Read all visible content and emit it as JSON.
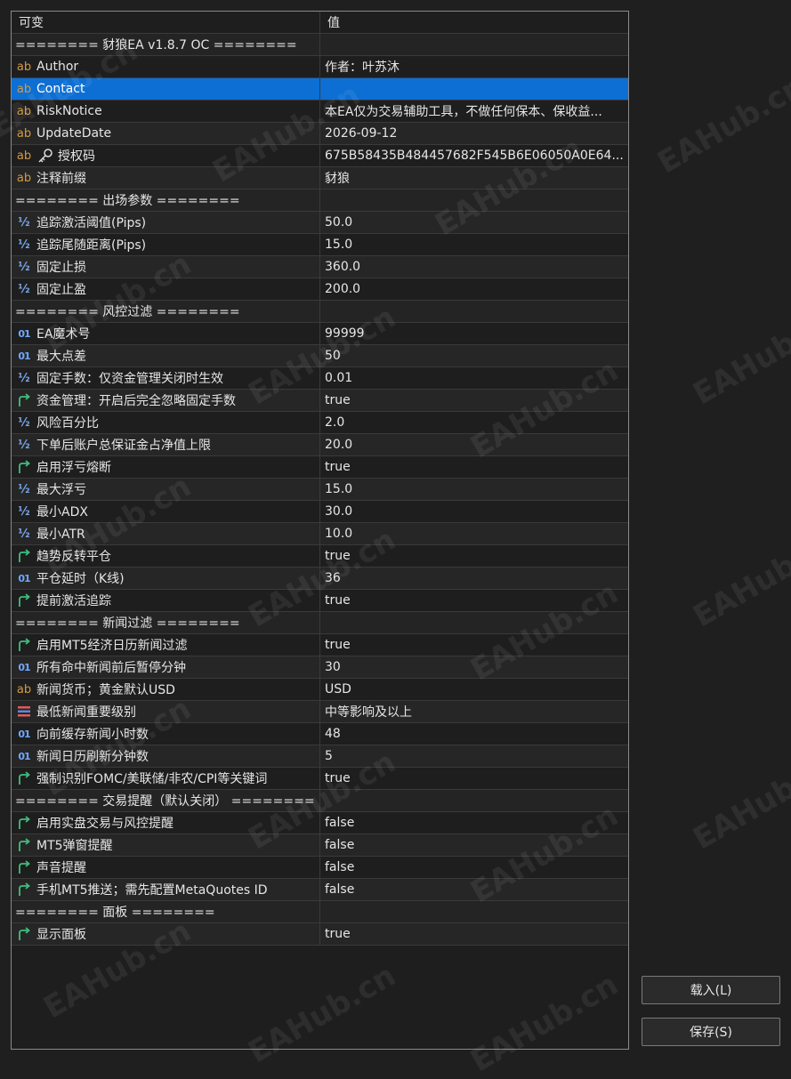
{
  "header": {
    "name": "可变",
    "value": "值"
  },
  "rows": [
    {
      "type": "section",
      "name": "======== 豺狼EA v1.8.7 OC ========",
      "value": ""
    },
    {
      "type": "str",
      "name": "Author",
      "value": "作者：叶苏沐"
    },
    {
      "type": "str",
      "name": "Contact",
      "value": "",
      "selected": true
    },
    {
      "type": "str",
      "name": "RiskNotice",
      "value": "本EA仅为交易辅助工具，不做任何保本、保收益..."
    },
    {
      "type": "str",
      "name": "UpdateDate",
      "value": "2026-09-12"
    },
    {
      "type": "str",
      "name": "授权码",
      "value": "675B58435B484457682F545B6E06050A0E64...",
      "key": true
    },
    {
      "type": "str",
      "name": "注释前缀",
      "value": "豺狼"
    },
    {
      "type": "section",
      "name": "======== 出场参数 ========",
      "value": ""
    },
    {
      "type": "dbl",
      "name": "追踪激活阈值(Pips)",
      "value": "50.0"
    },
    {
      "type": "dbl",
      "name": "追踪尾随距离(Pips)",
      "value": "15.0"
    },
    {
      "type": "dbl",
      "name": "固定止损",
      "value": "360.0"
    },
    {
      "type": "dbl",
      "name": "固定止盈",
      "value": "200.0"
    },
    {
      "type": "section",
      "name": "======== 风控过滤 ========",
      "value": ""
    },
    {
      "type": "int",
      "name": "EA魔术号",
      "value": "99999"
    },
    {
      "type": "int",
      "name": "最大点差",
      "value": "50"
    },
    {
      "type": "dbl",
      "name": "固定手数：仅资金管理关闭时生效",
      "value": "0.01"
    },
    {
      "type": "bool",
      "name": "资金管理：开启后完全忽略固定手数",
      "value": "true"
    },
    {
      "type": "dbl",
      "name": "风险百分比",
      "value": "2.0"
    },
    {
      "type": "dbl",
      "name": "下单后账户总保证金占净值上限",
      "value": "20.0"
    },
    {
      "type": "bool",
      "name": "启用浮亏熔断",
      "value": "true"
    },
    {
      "type": "dbl",
      "name": "最大浮亏",
      "value": "15.0"
    },
    {
      "type": "dbl",
      "name": "最小ADX",
      "value": "30.0"
    },
    {
      "type": "dbl",
      "name": "最小ATR",
      "value": "10.0"
    },
    {
      "type": "bool",
      "name": "趋势反转平仓",
      "value": "true"
    },
    {
      "type": "int",
      "name": "平仓延时（K线)",
      "value": "36"
    },
    {
      "type": "bool",
      "name": "提前激活追踪",
      "value": "true"
    },
    {
      "type": "section",
      "name": "======== 新闻过滤 ========",
      "value": ""
    },
    {
      "type": "bool",
      "name": "启用MT5经济日历新闻过滤",
      "value": "true"
    },
    {
      "type": "int",
      "name": "所有命中新闻前后暂停分钟",
      "value": "30"
    },
    {
      "type": "str",
      "name": "新闻货币；黄金默认USD",
      "value": "USD"
    },
    {
      "type": "enum",
      "name": "最低新闻重要级别",
      "value": "中等影响及以上"
    },
    {
      "type": "int",
      "name": "向前缓存新闻小时数",
      "value": "48"
    },
    {
      "type": "int",
      "name": "新闻日历刷新分钟数",
      "value": "5"
    },
    {
      "type": "bool",
      "name": "强制识别FOMC/美联储/非农/CPI等关键词",
      "value": "true"
    },
    {
      "type": "section",
      "name": "======== 交易提醒（默认关闭） ========",
      "value": ""
    },
    {
      "type": "bool",
      "name": "启用实盘交易与风控提醒",
      "value": "false"
    },
    {
      "type": "bool",
      "name": "MT5弹窗提醒",
      "value": "false"
    },
    {
      "type": "bool",
      "name": "声音提醒",
      "value": "false"
    },
    {
      "type": "bool",
      "name": "手机MT5推送；需先配置MetaQuotes ID",
      "value": "false"
    },
    {
      "type": "section",
      "name": "======== 面板 ========",
      "value": ""
    },
    {
      "type": "bool",
      "name": "显示面板",
      "value": "true"
    }
  ],
  "buttons": {
    "load": "载入(L)",
    "save": "保存(S)"
  },
  "watermark_text": "EAHub.cn",
  "icon_glyphs": {
    "str": "ab",
    "dbl": "½",
    "int": "01"
  },
  "colors": {
    "selected": "#0d6fd3",
    "string_icon": "#d39b42",
    "number_icon": "#6fa8ff",
    "bool_icon": "#3fbf7f"
  }
}
